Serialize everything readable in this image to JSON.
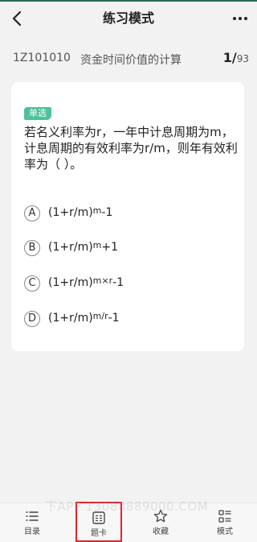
{
  "header": {
    "title": "练习模式",
    "back_icon": "chevron-left-icon",
    "more_icon": "more-dots-icon"
  },
  "chapter": {
    "code": "1Z101010",
    "name": "资金时间价值的计算",
    "current": "1",
    "separator": "/",
    "total": "93"
  },
  "question": {
    "type_tag": "单选",
    "text": "若名义利率为r，一年中计息周期为m，计息周期的有效利率为r/m，则年有效利率为（ ）。",
    "options": [
      {
        "letter": "A",
        "base": "(1+r/m)",
        "sup": "m",
        "tail": "-1"
      },
      {
        "letter": "B",
        "base": "(1+r/m)",
        "sup": "m",
        "tail": "+1"
      },
      {
        "letter": "C",
        "base": "(1+r/m)",
        "sup": "m×r",
        "tail": "-1"
      },
      {
        "letter": "D",
        "base": "(1+r/m)",
        "sup": "m/r",
        "tail": "-1"
      }
    ]
  },
  "tabbar": {
    "items": [
      {
        "label": "目录",
        "icon": "list-icon"
      },
      {
        "label": "题卡",
        "icon": "answer-card-icon"
      },
      {
        "label": "收藏",
        "icon": "star-icon"
      },
      {
        "label": "模式",
        "icon": "mode-grid-icon"
      }
    ],
    "highlight_color": "#e0242e"
  },
  "watermark": "下APP 13088889000.COM",
  "colors": {
    "accent": "#4cc29a",
    "topline": "#2f6b57"
  }
}
